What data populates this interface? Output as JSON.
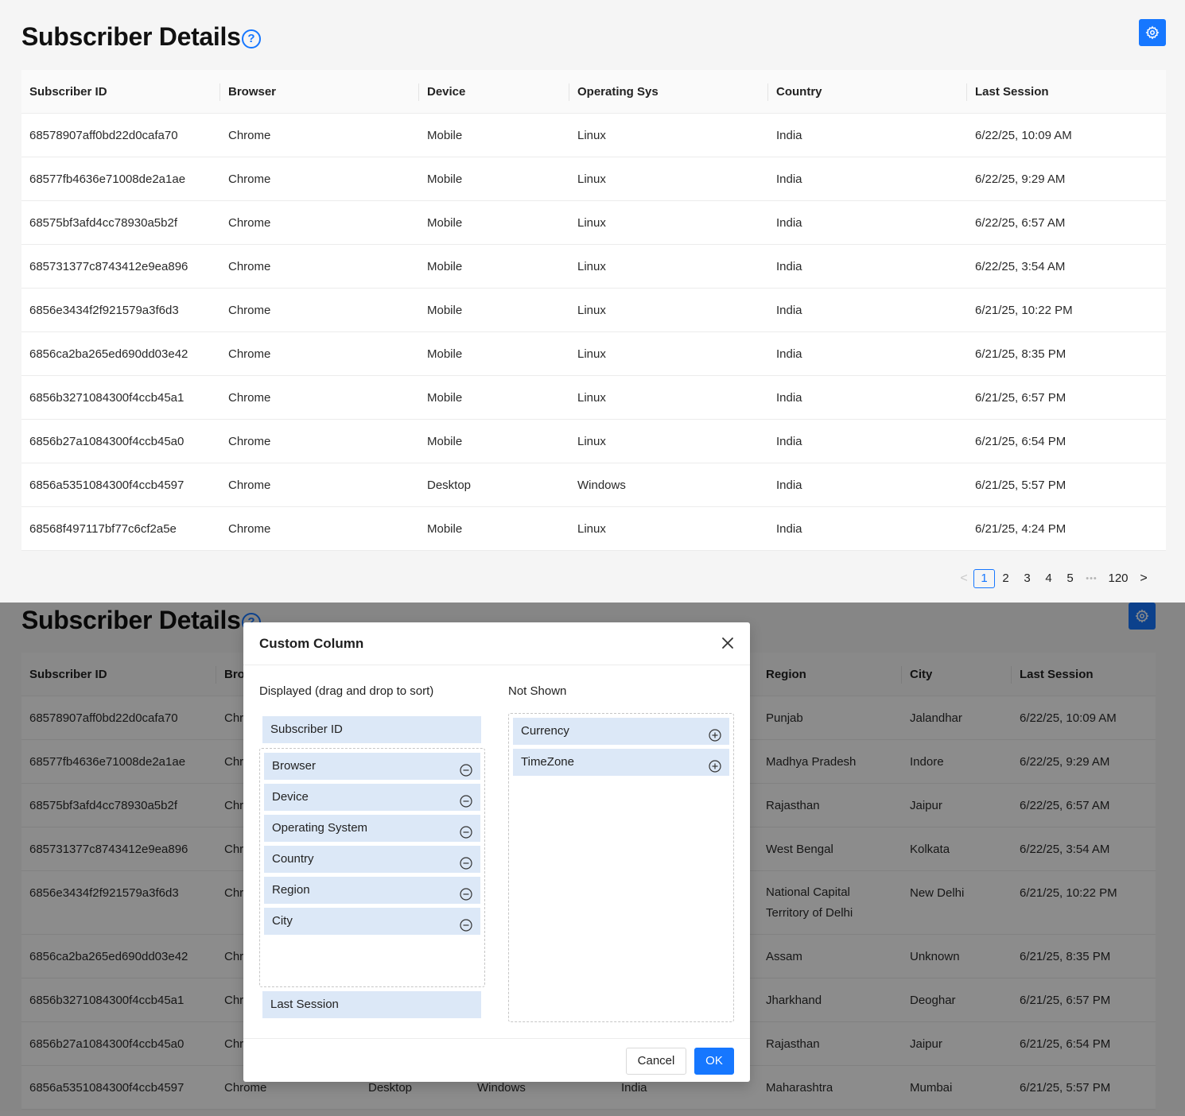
{
  "page": {
    "title": "Subscriber Details",
    "help_glyph": "?",
    "icons": {
      "help": "help-circle-icon",
      "settings": "gear-icon",
      "close": "close-icon",
      "remove": "minus-circle-icon",
      "add": "plus-circle-icon",
      "prev": "chevron-left-icon",
      "next": "chevron-right-icon"
    },
    "colors": {
      "accent": "#1677ff",
      "item_bg": "#dce8f7",
      "mask": "rgba(0,0,0,0.45)"
    }
  },
  "table_top": {
    "columns": [
      "Subscriber ID",
      "Browser",
      "Device",
      "Operating Sys",
      "Country",
      "Last Session"
    ],
    "rows": [
      [
        "68578907aff0bd22d0cafa70",
        "Chrome",
        "Mobile",
        "Linux",
        "India",
        "6/22/25, 10:09 AM"
      ],
      [
        "68577fb4636e71008de2a1ae",
        "Chrome",
        "Mobile",
        "Linux",
        "India",
        "6/22/25, 9:29 AM"
      ],
      [
        "68575bf3afd4cc78930a5b2f",
        "Chrome",
        "Mobile",
        "Linux",
        "India",
        "6/22/25, 6:57 AM"
      ],
      [
        "685731377c8743412e9ea896",
        "Chrome",
        "Mobile",
        "Linux",
        "India",
        "6/22/25, 3:54 AM"
      ],
      [
        "6856e3434f2f921579a3f6d3",
        "Chrome",
        "Mobile",
        "Linux",
        "India",
        "6/21/25, 10:22 PM"
      ],
      [
        "6856ca2ba265ed690dd03e42",
        "Chrome",
        "Mobile",
        "Linux",
        "India",
        "6/21/25, 8:35 PM"
      ],
      [
        "6856b3271084300f4ccb45a1",
        "Chrome",
        "Mobile",
        "Linux",
        "India",
        "6/21/25, 6:57 PM"
      ],
      [
        "6856b27a1084300f4ccb45a0",
        "Chrome",
        "Mobile",
        "Linux",
        "India",
        "6/21/25, 6:54 PM"
      ],
      [
        "6856a5351084300f4ccb4597",
        "Chrome",
        "Desktop",
        "Windows",
        "India",
        "6/21/25, 5:57 PM"
      ],
      [
        "68568f497117bf77c6cf2a5e",
        "Chrome",
        "Mobile",
        "Linux",
        "India",
        "6/21/25, 4:24 PM"
      ]
    ]
  },
  "pagination": {
    "pages": [
      "1",
      "2",
      "3",
      "4",
      "5"
    ],
    "ellipsis": "•••",
    "last": "120",
    "current": "1",
    "prev_glyph": "<",
    "next_glyph": ">"
  },
  "table_bottom": {
    "columns": [
      "Subscriber ID",
      "Bro",
      "Region",
      "City",
      "Last Session"
    ],
    "rows": [
      [
        "68578907aff0bd22d0cafa70",
        "Chr",
        "Punjab",
        "Jalandhar",
        "6/22/25, 10:09 AM"
      ],
      [
        "68577fb4636e71008de2a1ae",
        "Chr",
        "Madhya Pradesh",
        "Indore",
        "6/22/25, 9:29 AM"
      ],
      [
        "68575bf3afd4cc78930a5b2f",
        "Chr",
        "Rajasthan",
        "Jaipur",
        "6/22/25, 6:57 AM"
      ],
      [
        "685731377c8743412e9ea896",
        "Chr",
        "West Bengal",
        "Kolkata",
        "6/22/25, 3:54 AM"
      ],
      [
        "6856e3434f2f921579a3f6d3",
        "Chr",
        "National Capital Territory of Delhi",
        "New Delhi",
        "6/21/25, 10:22 PM"
      ],
      [
        "6856ca2ba265ed690dd03e42",
        "Chr",
        "Assam",
        "Unknown",
        "6/21/25, 8:35 PM"
      ],
      [
        "6856b3271084300f4ccb45a1",
        "Chr",
        "Jharkhand",
        "Deoghar",
        "6/21/25, 6:57 PM"
      ],
      [
        "6856b27a1084300f4ccb45a0",
        "Chr",
        "Rajasthan",
        "Jaipur",
        "6/21/25, 6:54 PM"
      ]
    ],
    "last_row": [
      "6856a5351084300f4ccb4597",
      "Chrome",
      "Desktop",
      "Windows",
      "India",
      "Maharashtra",
      "Mumbai",
      "6/21/25, 5:57 PM"
    ]
  },
  "modal": {
    "title": "Custom Column",
    "displayed_label": "Displayed (drag and drop to sort)",
    "not_shown_label": "Not Shown",
    "fixed_first": "Subscriber ID",
    "displayed": [
      "Browser",
      "Device",
      "Operating System",
      "Country",
      "Region",
      "City"
    ],
    "fixed_last": "Last Session",
    "not_shown": [
      "Currency",
      "TimeZone"
    ],
    "cancel_label": "Cancel",
    "ok_label": "OK"
  }
}
